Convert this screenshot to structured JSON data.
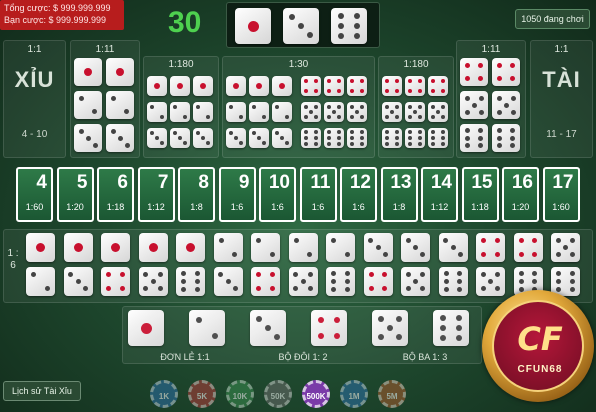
{
  "header": {
    "total_bet_label": "Tổng cược: $ 999.999.999",
    "your_bet_label": "Bạn cược: $ 999.999.999",
    "timer": "30",
    "online": "1050 đang chơi",
    "result_dice": [
      1,
      3,
      6
    ]
  },
  "xiu": {
    "ratio": "1:1",
    "title": "XỈU",
    "range": "4 - 10"
  },
  "tai": {
    "ratio": "1:1",
    "title": "TÀI",
    "range": "11 - 17"
  },
  "double_left": {
    "ratio": "1:11"
  },
  "double_right": {
    "ratio": "1:11"
  },
  "triple_left": {
    "ratio": "1:180"
  },
  "any_triple": {
    "ratio": "1:30"
  },
  "triple_right": {
    "ratio": "1:180"
  },
  "totals": [
    {
      "num": "4",
      "ratio": "1:60"
    },
    {
      "num": "5",
      "ratio": "1:20"
    },
    {
      "num": "6",
      "ratio": "1:18"
    },
    {
      "num": "7",
      "ratio": "1:12"
    },
    {
      "num": "8",
      "ratio": "1:8"
    },
    {
      "num": "9",
      "ratio": "1:6"
    },
    {
      "num": "10",
      "ratio": "1:6"
    },
    {
      "num": "11",
      "ratio": "1:6"
    },
    {
      "num": "12",
      "ratio": "1:6"
    },
    {
      "num": "13",
      "ratio": "1:8"
    },
    {
      "num": "14",
      "ratio": "1:12"
    },
    {
      "num": "15",
      "ratio": "1:18"
    },
    {
      "num": "16",
      "ratio": "1:20"
    },
    {
      "num": "17",
      "ratio": "1:60"
    }
  ],
  "combo_ratio": "1 : 6",
  "bottom_labels": {
    "single": "ĐƠN LẺ 1:1",
    "pair": "BỘ ĐÔI 1: 2",
    "triple": "BỘ BA 1: 3"
  },
  "history_button": "Lịch sử Tài Xỉu",
  "chips": [
    {
      "label": "1K",
      "color": "#2d6fa8"
    },
    {
      "label": "5K",
      "color": "#b23a3a"
    },
    {
      "label": "10K",
      "color": "#3a8a4f"
    },
    {
      "label": "50K",
      "color": "#6a6a6a"
    },
    {
      "label": "500K",
      "color": "#7a3aa8"
    },
    {
      "label": "1M",
      "color": "#2d6fa8"
    },
    {
      "label": "5M",
      "color": "#a85a2d"
    }
  ],
  "logo_text": "CFUN68"
}
